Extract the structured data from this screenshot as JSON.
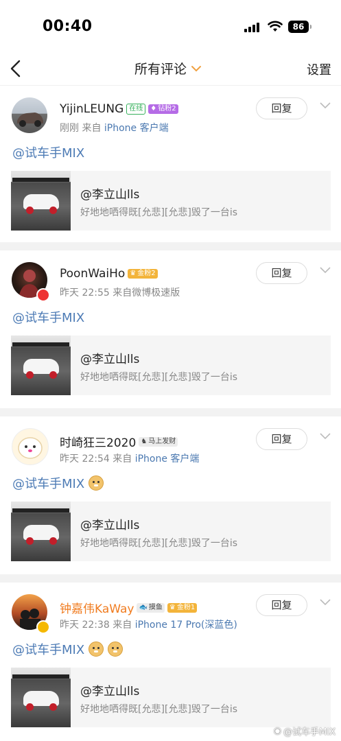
{
  "status_bar": {
    "time": "00:40",
    "battery": "86"
  },
  "nav": {
    "title": "所有评论",
    "settings": "设置"
  },
  "comments": [
    {
      "name": "YijinLEUNG",
      "badges": [
        "在线",
        "钻粉2"
      ],
      "meta_time": "刚刚",
      "meta_from": "来自",
      "device": "iPhone 客户端",
      "reply": "回复",
      "text": "@试车手MIX",
      "quote_title": "@李立山lls",
      "quote_text": "好地地哂得既[允悲][允悲]毁了一台is"
    },
    {
      "name": "PoonWaiHo",
      "badges": [
        "金粉2"
      ],
      "meta_time": "昨天 22:55",
      "meta_from": "来自微博极速版",
      "device": "",
      "reply": "回复",
      "text": "@试车手MIX",
      "quote_title": "@李立山lls",
      "quote_text": "好地地哂得既[允悲][允悲]毁了一台is"
    },
    {
      "name": "时崎狂三2020",
      "badges": [
        "马上发财"
      ],
      "meta_time": "昨天 22:54",
      "meta_from": "来自",
      "device": "iPhone 客户端",
      "reply": "回复",
      "text": "@试车手MIX",
      "quote_title": "@李立山lls",
      "quote_text": "好地地哂得既[允悲][允悲]毁了一台is"
    },
    {
      "name": "钟嘉伟KaWay",
      "badges": [
        "摸鱼",
        "金粉1"
      ],
      "meta_time": "昨天 22:38",
      "meta_from": "来自",
      "device": "iPhone 17 Pro(深蓝色)",
      "reply": "回复",
      "text": "@试车手MIX",
      "quote_title": "@李立山lls",
      "quote_text": "好地地哂得既[允悲][允悲]毁了一台is"
    }
  ],
  "watermark": "@试车手MIX",
  "colors": {
    "link": "#4d7bb5",
    "orange": "#f07c20",
    "meta": "#888888"
  }
}
